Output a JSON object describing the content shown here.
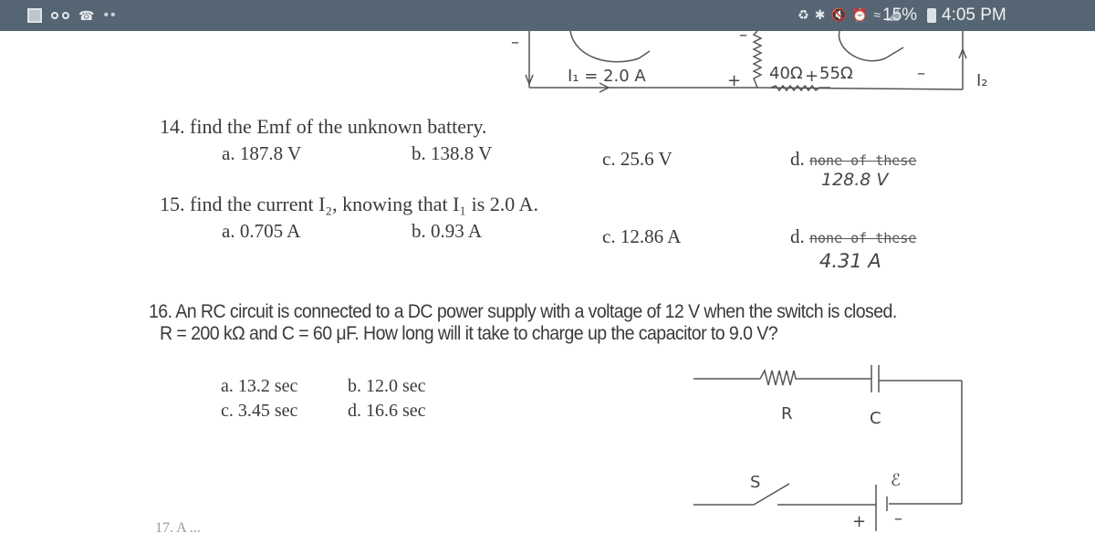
{
  "status_bar": {
    "left_icons": [
      "gallery-icon",
      "voicemail-icon",
      "wifi-calling-icon",
      "more-dots-icon"
    ],
    "right_icons": [
      "recycle-icon",
      "bluetooth-icon",
      "mute-icon",
      "alarm-icon",
      "wifi-icon",
      "signal-icon"
    ],
    "battery_percent": "15%",
    "time": "4:05 PM"
  },
  "top_circuit": {
    "i1_label": "I₁ = 2.0 A",
    "r1_label": "40Ω",
    "r2_label": "55Ω",
    "i2_label": "I₂",
    "plus": "+",
    "minus": "–"
  },
  "questions": [
    {
      "number": "14.",
      "text": "find the Emf of the unknown battery.",
      "options": [
        "a. 187.8 V",
        "b. 138.8 V",
        "c. 25.6 V"
      ],
      "option_d_prefix": "d.",
      "option_d_struck": "none of these",
      "handwritten_answer": "128.8 V"
    },
    {
      "number": "15.",
      "text": "find the current I₂, knowing that I₁ is 2.0 A.",
      "options": [
        "a. 0.705 A",
        "b. 0.93 A",
        "c. 12.86 A"
      ],
      "option_d_prefix": "d.",
      "option_d_struck": "none of these",
      "handwritten_answer": "4.31 A"
    },
    {
      "number": "16.",
      "line1": "An RC circuit is connected to a DC power supply with a voltage of 12 V when the switch is closed.",
      "line2": "R = 200 kΩ and C = 60 μF. How long will it take to charge up the capacitor to 9.0 V?",
      "options": [
        "a. 13.2 sec",
        "b. 12.0 sec",
        "c. 3.45 sec",
        "d. 16.6 sec"
      ]
    }
  ],
  "rc_circuit": {
    "r_label": "R",
    "c_label": "C",
    "s_label": "S",
    "emf_label": "ℰ",
    "plus": "+",
    "minus": "–"
  },
  "cutoff_text": "17. A  ...  "
}
